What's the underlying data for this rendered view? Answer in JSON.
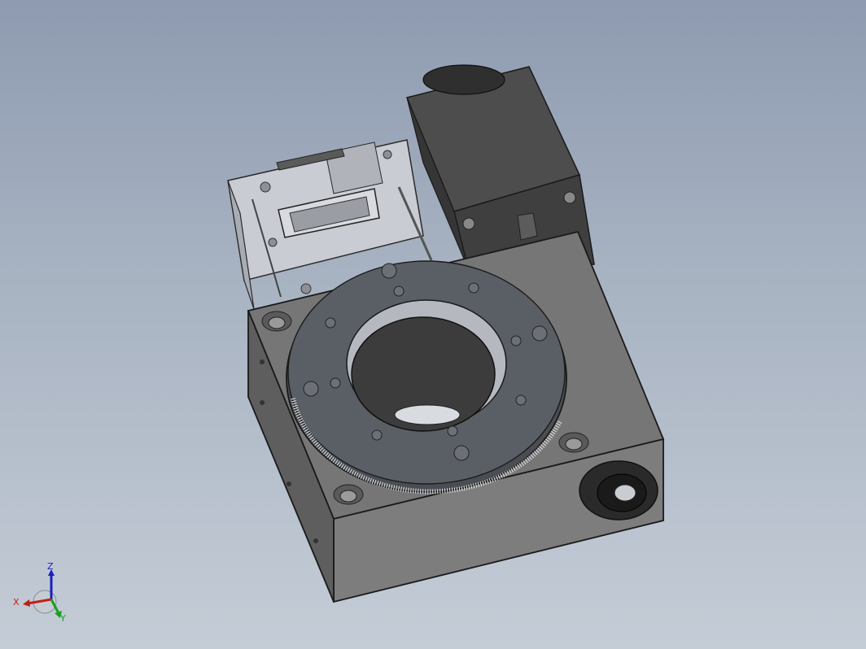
{
  "viewport": {
    "background_top": "#8e9bb0",
    "background_bottom": "#c4ccd6"
  },
  "model": {
    "body_color": "#6a6a6a",
    "ring_color": "#555a60",
    "motor_color": "#4a4a4a",
    "housing_color": "#b8bcc4"
  },
  "triad": {
    "x_label": "X",
    "y_label": "Y",
    "z_label": "Z",
    "x_color": "#c0201a",
    "y_color": "#1aa020",
    "z_color": "#1a20c0"
  }
}
